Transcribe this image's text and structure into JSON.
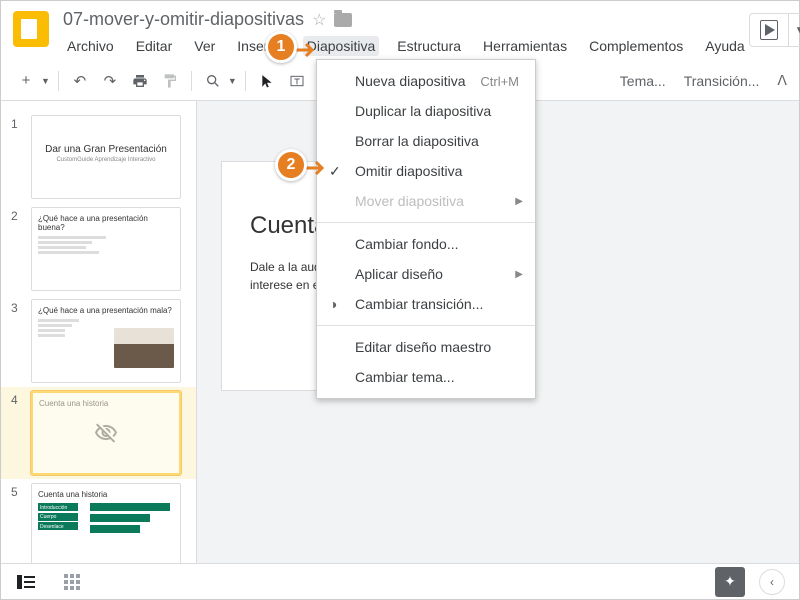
{
  "header": {
    "doc_title": "07-mover-y-omitir-diapositivas",
    "menu": {
      "archivo": "Archivo",
      "editar": "Editar",
      "ver": "Ver",
      "insertar": "Insertar",
      "diapositiva": "Diapositiva",
      "estructura": "Estructura",
      "herramientas": "Herramientas",
      "complementos": "Complementos",
      "ayuda": "Ayuda"
    }
  },
  "toolbar": {
    "tema": "Tema...",
    "transicion": "Transición..."
  },
  "dropdown": {
    "nueva": "Nueva diapositiva",
    "nueva_shortcut": "Ctrl+M",
    "duplicar": "Duplicar la diapositiva",
    "borrar": "Borrar la diapositiva",
    "omitir": "Omitir diapositiva",
    "mover": "Mover diapositiva",
    "cambiar_fondo": "Cambiar fondo...",
    "aplicar_diseno": "Aplicar diseño",
    "cambiar_transicion": "Cambiar transición...",
    "editar_maestro": "Editar diseño maestro",
    "cambiar_tema": "Cambiar tema..."
  },
  "thumbs": {
    "s1": {
      "num": "1",
      "title": "Dar una Gran Presentación",
      "sub": "CustomGuide Aprendizaje Interactivo"
    },
    "s2": {
      "num": "2",
      "title": "¿Qué hace a una presentación buena?"
    },
    "s3": {
      "num": "3",
      "title": "¿Qué hace a una presentación mala?"
    },
    "s4": {
      "num": "4",
      "title": "Cuenta una historia"
    },
    "s5": {
      "num": "5",
      "title": "Cuenta una historia",
      "b1": "Introducción",
      "b2": "Cuerpo",
      "b3": "Desenlace"
    }
  },
  "canvas": {
    "title": "Cuenta",
    "body1": "Dale a la audie",
    "body2": "interese en el"
  },
  "annotations": {
    "a1": "1",
    "a2": "2"
  }
}
